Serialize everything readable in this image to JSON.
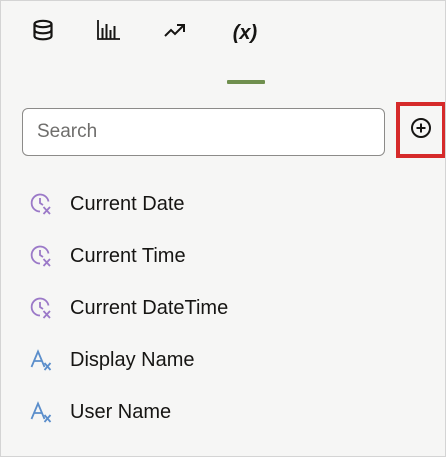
{
  "tabs": [
    {
      "icon": "database-icon",
      "label": "",
      "active": false
    },
    {
      "icon": "bar-chart-icon",
      "label": "",
      "active": false
    },
    {
      "icon": "trend-arrow-icon",
      "label": "",
      "active": false
    },
    {
      "icon": "variable-icon",
      "label": "(x)",
      "active": true
    }
  ],
  "search": {
    "placeholder": "Search",
    "value": ""
  },
  "add_button": {
    "icon": "add-circle-icon",
    "highlighted": true
  },
  "variables": [
    {
      "label": "Current Date",
      "icon": "clock-variable-icon"
    },
    {
      "label": "Current Time",
      "icon": "clock-variable-icon"
    },
    {
      "label": "Current DateTime",
      "icon": "clock-variable-icon"
    },
    {
      "label": "Display Name",
      "icon": "text-variable-icon"
    },
    {
      "label": "User Name",
      "icon": "text-variable-icon"
    }
  ],
  "colors": {
    "active_tab_underline": "#6f8f4e",
    "highlight_border": "#d62a2a",
    "clock_icon": "#9b79c8",
    "text_icon": "#5b8ecb"
  }
}
